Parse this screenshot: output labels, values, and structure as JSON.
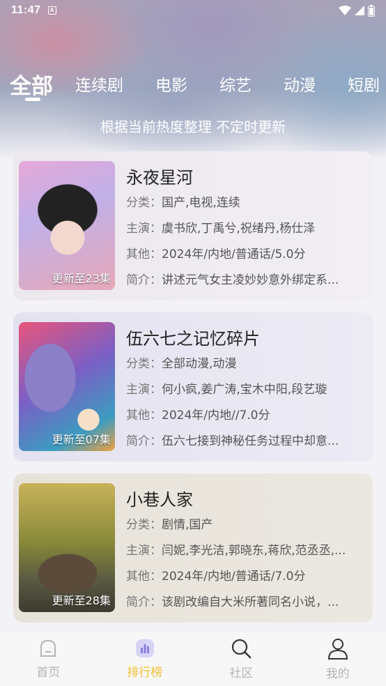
{
  "status_bar": {
    "time": "11:47"
  },
  "tabs": [
    {
      "label": "全部"
    },
    {
      "label": "连续剧"
    },
    {
      "label": "电影"
    },
    {
      "label": "综艺"
    },
    {
      "label": "动漫"
    },
    {
      "label": "短剧"
    }
  ],
  "subtitle": "根据当前热度整理 不定时更新",
  "field_labels": {
    "category": "分类：",
    "cast": "主演：",
    "other": "其他：",
    "intro": "简介："
  },
  "items": [
    {
      "title": "永夜星河",
      "badge": "更新至23集",
      "category": "国产,电视,连续",
      "cast": "虞书欣,丁禹兮,祝绪丹,杨仕泽",
      "other": "2024年/内地/普通话/5.0分",
      "intro": "讲述元气女主凌妙妙意外绑定系..."
    },
    {
      "title": "伍六七之记忆碎片",
      "badge": "更新至07集",
      "category": "全部动漫,动漫",
      "cast": "何小疯,姜广涛,宝木中阳,段艺璇",
      "other": "2024年/内地//7.0分",
      "intro": "伍六七接到神秘任务过程中却意..."
    },
    {
      "title": "小巷人家",
      "badge": "更新至28集",
      "category": "剧情,国产",
      "cast": "闫妮,李光洁,郭晓东,蒋欣,范丞丞,...",
      "other": "2024年/内地/普通话/7.0分",
      "intro": "该剧改编自大米所著同名小说，..."
    }
  ],
  "bottom_nav": [
    {
      "label": "首页",
      "icon": "home-icon"
    },
    {
      "label": "排行榜",
      "icon": "ranking-icon",
      "active": true
    },
    {
      "label": "社区",
      "icon": "search-icon"
    },
    {
      "label": "我的",
      "icon": "user-icon"
    }
  ],
  "colors": {
    "active": "#f2c230",
    "inactive": "#b4b4b4"
  }
}
